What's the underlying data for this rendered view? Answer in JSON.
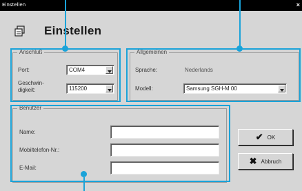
{
  "window": {
    "title": "Einstellen",
    "close_glyph": "×"
  },
  "header": {
    "title": "Einstellen",
    "icon": "settings-dialog-icon"
  },
  "anschluss": {
    "legend": "Anschluß",
    "port_label": "Port:",
    "port_value": "COM4",
    "speed_label_1": "Geschwin-",
    "speed_label_2": "digkeit:",
    "speed_value": "115200"
  },
  "allgemeinen": {
    "legend": "Allgemeinen",
    "sprache_label": "Sprache:",
    "sprache_value": "Nederlands",
    "modell_label": "Modell:",
    "modell_value": "Samsung SGH-M 00"
  },
  "benutzer": {
    "legend": "Benutzer",
    "name_label": "Name:",
    "mobil_label": "Mobiltelefon-Nr.:",
    "email_label": "E-Mail:",
    "name_value": "",
    "mobil_value": "",
    "email_value": ""
  },
  "buttons": {
    "ok_label": "OK",
    "ok_glyph": "✔",
    "cancel_label": "Abbruch",
    "cancel_glyph": "✖"
  },
  "colors": {
    "highlight": "#1aa3d9",
    "dialog_bg": "#d6d6d6",
    "titlebar_bg": "#000000"
  }
}
